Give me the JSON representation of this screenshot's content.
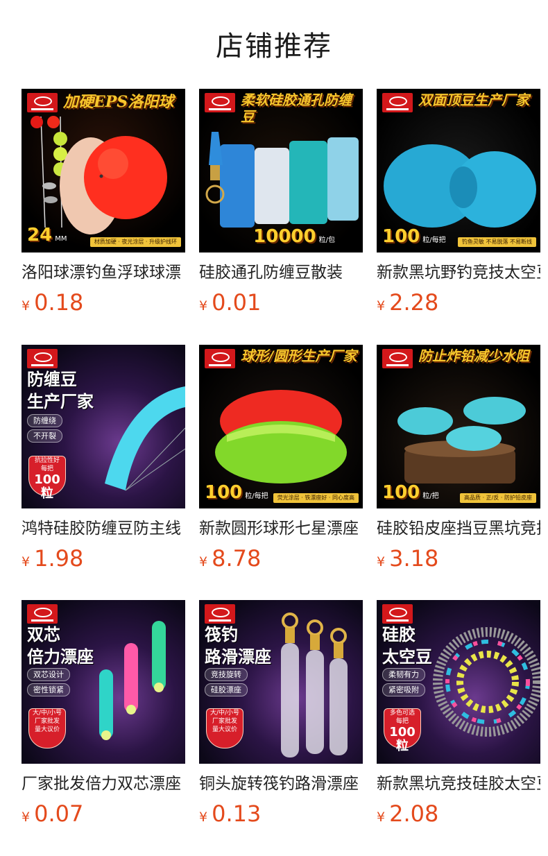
{
  "header": {
    "title": "店铺推荐"
  },
  "currency": "¥",
  "products": [
    {
      "title": "洛阳球漂钓鱼浮球球漂",
      "price": "0.18",
      "image": {
        "headline": "加硬EPS洛阳球",
        "count": "24",
        "count_unit": "MM",
        "footer": "材质加硬 · 夜光涂层 · 升级护线环"
      }
    },
    {
      "title": "硅胶通孔防缠豆散装",
      "price": "0.01",
      "image": {
        "headline": "柔软硅胶通孔防缠豆",
        "count": "10000",
        "count_unit": "粒/包"
      }
    },
    {
      "title": "新款黑坑野钓竞技太空豆",
      "price": "2.28",
      "image": {
        "headline": "双面顶豆生产厂家",
        "count": "100",
        "count_unit": "粒/每把",
        "footer": "钓鱼灵敏 不易脱落 不易断线"
      }
    },
    {
      "title": "鸿特硅胶防缠豆防主线",
      "price": "1.98",
      "image": {
        "side_title": "防缠豆\n生产厂家",
        "features": [
          "防缠绕",
          "不开裂"
        ],
        "badge_top": "抗拉性好",
        "badge_mid": "每把",
        "badge_num": "100粒"
      }
    },
    {
      "title": "新款圆形球形七星漂座",
      "price": "8.78",
      "image": {
        "headline": "球形/圆形生产厂家",
        "count": "100",
        "count_unit": "粒/每把",
        "footer": "荧光涂层 · 铁漂座好 · 同心度高"
      }
    },
    {
      "title": "硅胶铅皮座挡豆黑坑竞技",
      "price": "3.18",
      "image": {
        "headline": "防止炸铅减少水阻",
        "count": "100",
        "count_unit": "粒/把",
        "footer": "高品质 · 正/反 · 防护铅皮座"
      }
    },
    {
      "title": "厂家批发倍力双芯漂座",
      "price": "0.07",
      "image": {
        "side_title": "双芯\n倍力漂座",
        "features": [
          "双芯设计",
          "密性锁紧"
        ],
        "badge_top": "大/中/小号",
        "badge_mid": "厂家批发",
        "badge_num": "量大议价"
      }
    },
    {
      "title": "铜头旋转筏钓路滑漂座",
      "price": "0.13",
      "image": {
        "side_title": "筏钓\n路滑漂座",
        "features": [
          "竞技旋转",
          "硅胶漂座"
        ],
        "badge_top": "大/中/小号",
        "badge_mid": "厂家批发",
        "badge_num": "量大议价"
      }
    },
    {
      "title": "新款黑坑竞技硅胶太空豆",
      "price": "2.08",
      "image": {
        "side_title": "硅胶\n太空豆",
        "features": [
          "柔韧有力",
          "紧密吸附"
        ],
        "badge_top": "多色可选",
        "badge_mid": "每把",
        "badge_num": "100粒"
      }
    }
  ],
  "colors": {
    "price": "#e44a1c",
    "headline": "#f7c62c",
    "logo": "#d3181b"
  }
}
